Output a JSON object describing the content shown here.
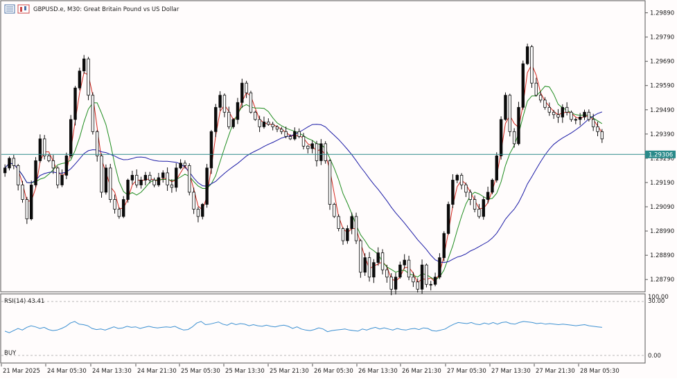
{
  "header": {
    "symbol_text": "GBPUSD.e, M30:  Great Britain Pound vs US Dollar"
  },
  "price_panel": {
    "current_price_label": "1.29306",
    "current_price": 1.29306,
    "price_labels": [
      "1.29890",
      "1.29790",
      "1.29690",
      "1.29590",
      "1.29490",
      "1.29390",
      "1.29290",
      "1.29190",
      "1.29090",
      "1.28990",
      "1.28890",
      "1.28790"
    ]
  },
  "indicator_panel": {
    "title": "RSI(14) 43.41",
    "signal_text": "BUY",
    "level_labels": [
      "100.00",
      "30.00",
      "0.00"
    ],
    "upper_level": 30.0
  },
  "time_axis": {
    "labels": [
      "21 Mar 2025",
      "24 Mar 05:30",
      "24 Mar 13:30",
      "24 Mar 21:30",
      "25 Mar 05:30",
      "25 Mar 13:30",
      "25 Mar 21:30",
      "26 Mar 05:30",
      "26 Mar 13:30",
      "26 Mar 21:30",
      "27 Mar 05:30",
      "27 Mar 13:30",
      "27 Mar 21:30",
      "28 Mar 05:30"
    ]
  },
  "colors": {
    "bull_candle": "#0a0a0a",
    "bear_candle": "#0a0a0a",
    "ma_fast": "#d4251b",
    "ma_mid": "#1e8c1e",
    "ma_slow": "#1a1aa6",
    "current_price_line": "#2a8a8a",
    "rsi_line": "#3a8fd1",
    "price_label_bg": "#2a8a8a"
  },
  "chart_data": {
    "type": "candlestick",
    "symbol": "GBPUSD.e",
    "timeframe": "M30",
    "y_range": [
      1.28745,
      1.2992
    ],
    "close_path": [
      1.2925,
      1.2929,
      1.2926,
      1.2918,
      1.2912,
      1.2904,
      1.2918,
      1.2928,
      1.2937,
      1.293,
      1.2928,
      1.2925,
      1.2918,
      1.2922,
      1.293,
      1.2945,
      1.2958,
      1.2965,
      1.297,
      1.2955,
      1.294,
      1.293,
      1.2915,
      1.2925,
      1.2912,
      1.2908,
      1.2905,
      1.2912,
      1.292,
      1.2922,
      1.2918,
      1.292,
      1.2922,
      1.292,
      1.2918,
      1.2921,
      1.2923,
      1.2918,
      1.2917,
      1.2925,
      1.2927,
      1.2926,
      1.2915,
      1.2908,
      1.2905,
      1.291,
      1.2925,
      1.294,
      1.295,
      1.2955,
      1.2948,
      1.2942,
      1.2945,
      1.2952,
      1.296,
      1.2956,
      1.2948,
      1.2945,
      1.2942,
      1.2944,
      1.2943,
      1.2942,
      1.2941,
      1.294,
      1.2938,
      1.2937,
      1.294,
      1.2938,
      1.2934,
      1.2933,
      1.2935,
      1.2928,
      1.2935,
      1.2928,
      1.291,
      1.2905,
      1.29,
      1.2895,
      1.29,
      1.2905,
      1.2895,
      1.2882,
      1.2888,
      1.288,
      1.2886,
      1.289,
      1.2883,
      1.288,
      1.2875,
      1.288,
      1.2885,
      1.2887,
      1.288,
      1.2878,
      1.2875,
      1.2885,
      1.2877,
      1.2877,
      1.288,
      1.2888,
      1.2898,
      1.291,
      1.292,
      1.2922,
      1.2918,
      1.2915,
      1.2912,
      1.2908,
      1.2905,
      1.2912,
      1.2915,
      1.292,
      1.293,
      1.2945,
      1.2955,
      1.294,
      1.2935,
      1.295,
      1.2968,
      1.2975,
      1.296,
      1.2955,
      1.2953,
      1.295,
      1.2948,
      1.2947,
      1.2946,
      1.295,
      1.2948,
      1.2945,
      1.2945,
      1.2946,
      1.2948,
      1.2945,
      1.2942,
      1.294,
      1.2937
    ],
    "rsi": [
      45,
      42,
      46,
      50,
      47,
      52,
      55,
      53,
      50,
      52,
      48,
      46,
      47,
      50,
      54,
      60,
      63,
      58,
      57,
      55,
      50,
      48,
      49,
      47,
      50,
      53,
      50,
      51,
      54,
      52,
      53,
      50,
      52,
      54,
      52,
      51,
      52,
      53,
      52,
      54,
      50,
      47,
      48,
      53,
      60,
      63,
      57,
      58,
      60,
      62,
      58,
      56,
      60,
      57,
      59,
      58,
      55,
      57,
      55,
      54,
      56,
      54,
      53,
      55,
      56,
      54,
      50,
      53,
      49,
      47,
      46,
      48,
      51,
      49,
      44,
      46,
      47,
      48,
      49,
      47,
      46,
      45,
      49,
      47,
      50,
      52,
      49,
      51,
      49,
      47,
      50,
      48,
      47,
      49,
      50,
      48,
      51,
      50,
      46,
      45,
      47,
      49,
      54,
      58,
      61,
      60,
      59,
      61,
      58,
      57,
      60,
      58,
      61,
      58,
      61,
      62,
      59,
      58,
      61,
      63,
      62,
      61,
      59,
      60,
      58,
      59,
      58,
      57,
      58,
      57,
      56,
      55,
      56,
      57,
      55,
      54,
      53,
      52
    ]
  }
}
